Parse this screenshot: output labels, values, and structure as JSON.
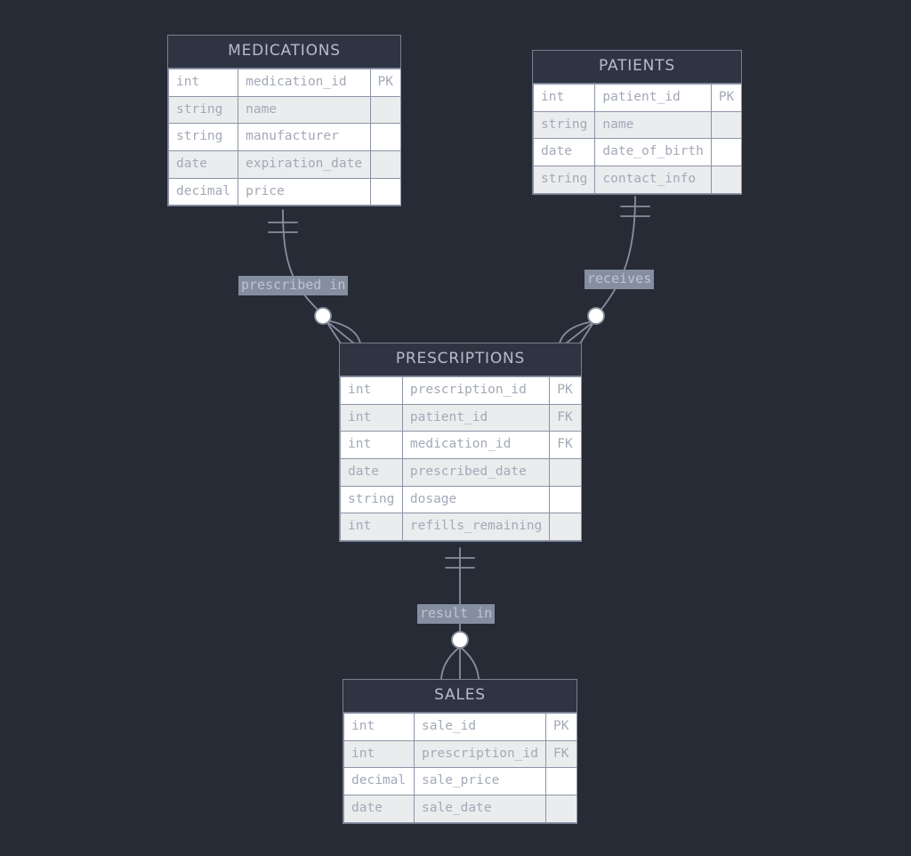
{
  "diagram": {
    "type": "entity-relationship-diagram",
    "background_color": "#272b35",
    "entities": [
      {
        "id": "medications",
        "name": "MEDICATIONS",
        "attributes": [
          {
            "type": "int",
            "name": "medication_id",
            "key": "PK"
          },
          {
            "type": "string",
            "name": "name",
            "key": ""
          },
          {
            "type": "string",
            "name": "manufacturer",
            "key": ""
          },
          {
            "type": "date",
            "name": "expiration_date",
            "key": ""
          },
          {
            "type": "decimal",
            "name": "price",
            "key": ""
          }
        ]
      },
      {
        "id": "patients",
        "name": "PATIENTS",
        "attributes": [
          {
            "type": "int",
            "name": "patient_id",
            "key": "PK"
          },
          {
            "type": "string",
            "name": "name",
            "key": ""
          },
          {
            "type": "date",
            "name": "date_of_birth",
            "key": ""
          },
          {
            "type": "string",
            "name": "contact_info",
            "key": ""
          }
        ]
      },
      {
        "id": "prescriptions",
        "name": "PRESCRIPTIONS",
        "attributes": [
          {
            "type": "int",
            "name": "prescription_id",
            "key": "PK"
          },
          {
            "type": "int",
            "name": "patient_id",
            "key": "FK"
          },
          {
            "type": "int",
            "name": "medication_id",
            "key": "FK"
          },
          {
            "type": "date",
            "name": "prescribed_date",
            "key": ""
          },
          {
            "type": "string",
            "name": "dosage",
            "key": ""
          },
          {
            "type": "int",
            "name": "refills_remaining",
            "key": ""
          }
        ]
      },
      {
        "id": "sales",
        "name": "SALES",
        "attributes": [
          {
            "type": "int",
            "name": "sale_id",
            "key": "PK"
          },
          {
            "type": "int",
            "name": "prescription_id",
            "key": "FK"
          },
          {
            "type": "decimal",
            "name": "sale_price",
            "key": ""
          },
          {
            "type": "date",
            "name": "sale_date",
            "key": ""
          }
        ]
      }
    ],
    "relationships": [
      {
        "id": "prescribed-in",
        "label": "prescribed in",
        "from": "MEDICATIONS",
        "to": "PRESCRIPTIONS",
        "from_cardinality": "exactly-one",
        "to_cardinality": "zero-or-many"
      },
      {
        "id": "receives",
        "label": "receives",
        "from": "PATIENTS",
        "to": "PRESCRIPTIONS",
        "from_cardinality": "exactly-one",
        "to_cardinality": "zero-or-many"
      },
      {
        "id": "result-in",
        "label": "result in",
        "from": "PRESCRIPTIONS",
        "to": "SALES",
        "from_cardinality": "exactly-one",
        "to_cardinality": "zero-or-many"
      }
    ]
  }
}
